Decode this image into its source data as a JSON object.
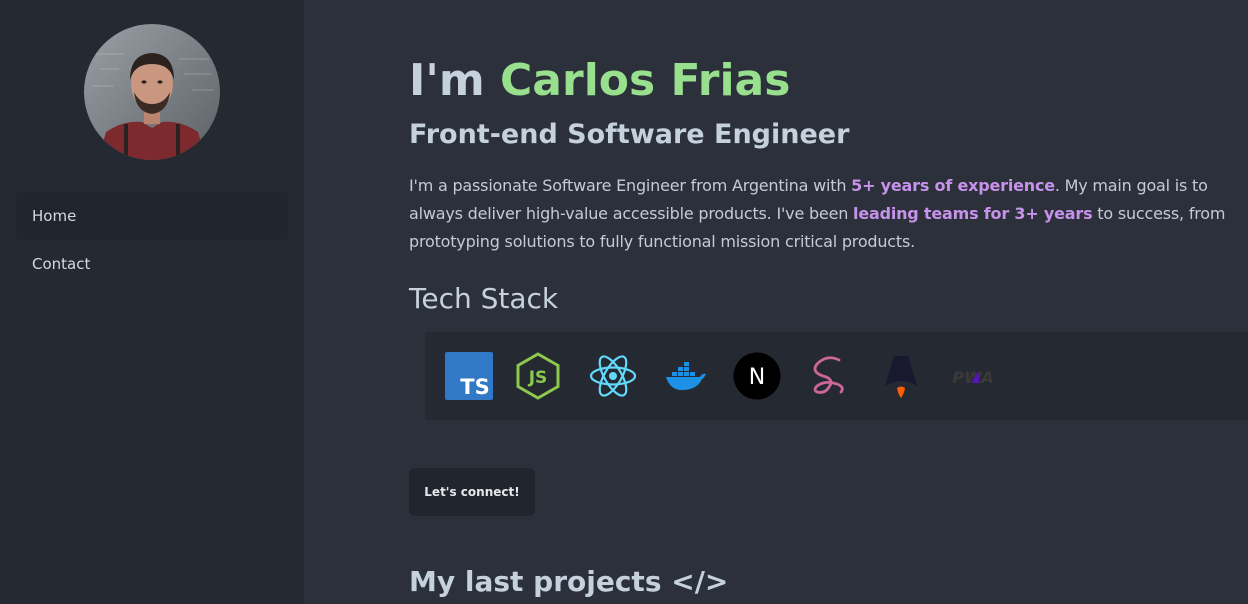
{
  "sidebar": {
    "avatar_alt": "Carlos Frias profile photo",
    "nav": [
      {
        "label": "Home",
        "active": true
      },
      {
        "label": "Contact",
        "active": false
      }
    ]
  },
  "hero": {
    "greeting": "I'm ",
    "name": "Carlos Frias",
    "role": "Front-end Software Engineer"
  },
  "bio": {
    "part1": "I'm a passionate Software Engineer from Argentina with ",
    "highlight1": "5+ years of experience",
    "part2": ". My main goal is to always deliver high-value accessible products. I've been ",
    "highlight2": "leading teams for 3+ years",
    "part3": " to success, from prototyping solutions to fully functional mission critical products."
  },
  "tech_stack": {
    "title": "Tech Stack",
    "items": [
      {
        "name": "typescript-icon",
        "label": "TS"
      },
      {
        "name": "nodejs-icon",
        "label": "JS"
      },
      {
        "name": "react-icon"
      },
      {
        "name": "docker-icon"
      },
      {
        "name": "nextjs-icon",
        "label": "N"
      },
      {
        "name": "sass-icon"
      },
      {
        "name": "astro-icon"
      },
      {
        "name": "pwa-icon",
        "label": "PWA"
      }
    ]
  },
  "cta": {
    "connect_label": "Let's connect!"
  },
  "projects": {
    "title": "My last projects </>"
  },
  "colors": {
    "accent_green": "#98e08e",
    "accent_purple": "#c792ea",
    "background": "#2b303b",
    "sidebar": "#252932"
  }
}
